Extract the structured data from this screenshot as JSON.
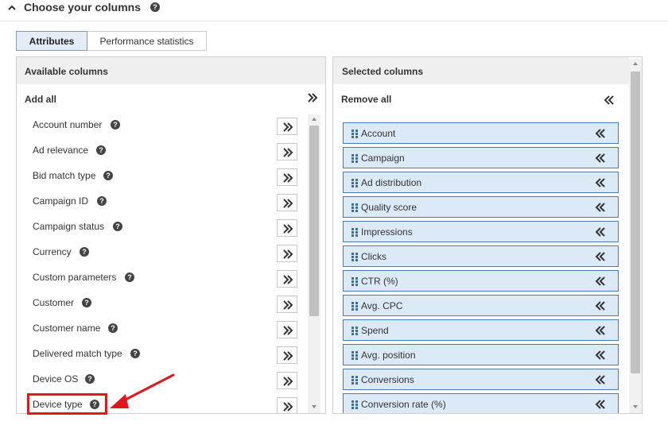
{
  "section": {
    "title": "Choose your columns",
    "help_icon": "question-circle-icon",
    "toggle_icon": "chevron-up-icon"
  },
  "tabs": [
    {
      "label": "Attributes",
      "active": true
    },
    {
      "label": "Performance statistics",
      "active": false
    }
  ],
  "available": {
    "title": "Available columns",
    "add_all_label": "Add all",
    "add_all_icon": "double-chevron-right-icon",
    "items": [
      {
        "label": "Account number"
      },
      {
        "label": "Ad relevance"
      },
      {
        "label": "Bid match type"
      },
      {
        "label": "Campaign ID"
      },
      {
        "label": "Campaign status"
      },
      {
        "label": "Currency"
      },
      {
        "label": "Custom parameters"
      },
      {
        "label": "Customer"
      },
      {
        "label": "Customer name"
      },
      {
        "label": "Delivered match type"
      },
      {
        "label": "Device OS"
      },
      {
        "label": "Device type",
        "highlighted": true
      }
    ]
  },
  "selected": {
    "title": "Selected columns",
    "remove_all_label": "Remove all",
    "remove_all_icon": "double-chevron-left-icon",
    "items": [
      {
        "label": "Account"
      },
      {
        "label": "Campaign"
      },
      {
        "label": "Ad distribution"
      },
      {
        "label": "Quality score"
      },
      {
        "label": "Impressions"
      },
      {
        "label": "Clicks"
      },
      {
        "label": "CTR (%)"
      },
      {
        "label": "Avg. CPC"
      },
      {
        "label": "Spend"
      },
      {
        "label": "Avg. position"
      },
      {
        "label": "Conversions"
      },
      {
        "label": "Conversion rate (%)"
      }
    ]
  },
  "colors": {
    "accent": "#4a78b4",
    "selected_bg": "#dce9f7",
    "annotation": "#e0181e",
    "tab_active_bg": "#e4ecf7"
  }
}
